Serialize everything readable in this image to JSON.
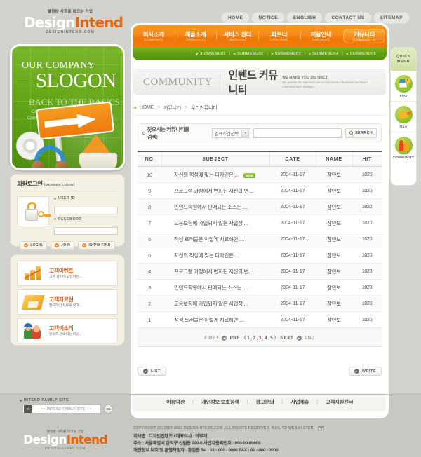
{
  "header": {
    "logo": {
      "tagline": "열정판 사회를 이끄는 기업",
      "name_1": "Design",
      "name_2": "Intend",
      "domain": "DESIGNINTEND.COM"
    },
    "topnav": [
      {
        "label": "HOME"
      },
      {
        "label": "NOTICE"
      },
      {
        "label": "ENGLISH"
      },
      {
        "label": "CONTACT US"
      },
      {
        "label": "SITEMAP"
      }
    ]
  },
  "gnb": {
    "items": [
      {
        "ko": "회사소개",
        "en": "[COMPANY]",
        "active": false
      },
      {
        "ko": "제품소개",
        "en": "[PRODUCT]",
        "active": false
      },
      {
        "ko": "서비스 센터",
        "en": "[SERVICE]",
        "active": false
      },
      {
        "ko": "파트너",
        "en": "[PARTNER]",
        "active": false
      },
      {
        "ko": "채용안내",
        "en": "[RECRUIT]",
        "active": false
      },
      {
        "ko": "커뮤니티",
        "en": "[COMMUNITY]",
        "active": true
      }
    ],
    "submenu": [
      {
        "label": "SUBMENU01"
      },
      {
        "label": "SUBMENU02"
      },
      {
        "label": "SUBMENU03"
      },
      {
        "label": "SUBMENU04"
      },
      {
        "label": "SUBMENU05"
      }
    ]
  },
  "hero": {
    "line1": "OUR COMPANY",
    "line2": "SLOGON",
    "line3": "BACK TO THE BASICS",
    "line4": "Client Focus, Talent Investment Group Contribution ... to support both individual & teams"
  },
  "page": {
    "title_en": "COMMUNITY",
    "title_ko": "인텐드 커뮤니티",
    "slogan_1": "WE MAKE YOU DISTINCT",
    "slogan_2": "We provide the optimized service for clients e-business and brand communication strategy...",
    "breadcrumb": {
      "home": "HOME",
      "level1": "커뮤니티",
      "level2": "우리커뮤니티"
    }
  },
  "search": {
    "label": "찾으시는 커뮤니티를 검색!",
    "select_value": "검색조건선택",
    "input_value": "",
    "input_placeholder": "",
    "button_label": "SEARCH"
  },
  "board": {
    "columns": [
      "NO",
      "SUBJECT",
      "DATE",
      "NAME",
      "HIT"
    ],
    "new_badge": "NEW",
    "rows": [
      {
        "no": "10",
        "subject": "자신의 적성에 맞는 디자인은....",
        "is_new": true,
        "date": "2004-11-17",
        "name": "잠만보",
        "hit": "1020"
      },
      {
        "no": "9",
        "subject": "프로그램 과정에서 변화된 자신의 변....",
        "is_new": false,
        "date": "2004-11-17",
        "name": "잠만보",
        "hit": "1020"
      },
      {
        "no": "8",
        "subject": "인텐드학원에서 판매되는 소스는 ....",
        "is_new": false,
        "date": "2004-11-17",
        "name": "잠만보",
        "hit": "1020"
      },
      {
        "no": "7",
        "subject": "고용보험에 가입되지 않은 사업장....",
        "is_new": false,
        "date": "2004-11-17",
        "name": "잠만보",
        "hit": "1020"
      },
      {
        "no": "6",
        "subject": "적성 트러블은 이렇게 치료하면 ....",
        "is_new": false,
        "date": "2004-11-17",
        "name": "잠만보",
        "hit": "1020"
      },
      {
        "no": "5",
        "subject": "자신의 적성에 맞는 디자인은 ....",
        "is_new": false,
        "date": "2004-11-17",
        "name": "잠만보",
        "hit": "1020"
      },
      {
        "no": "4",
        "subject": "프로그램 과정에서 변화된 자신의 변....",
        "is_new": false,
        "date": "2004-11-17",
        "name": "잠만보",
        "hit": "1020"
      },
      {
        "no": "3",
        "subject": "인텐드학원에서 판매되는 소스는 ....",
        "is_new": false,
        "date": "2004-11-17",
        "name": "잠만보",
        "hit": "1020"
      },
      {
        "no": "2",
        "subject": "고용보험에 가입되지 않은 사업장....",
        "is_new": false,
        "date": "2004-11-17",
        "name": "잠만보",
        "hit": "1020"
      },
      {
        "no": "1",
        "subject": "적성 트러블은 이렇게 치료하면 ....",
        "is_new": false,
        "date": "2004-11-17",
        "name": "잠만보",
        "hit": "1020"
      }
    ],
    "pager": {
      "first": "FIRST",
      "pre": "PRE",
      "next": "NEXT",
      "end": "END",
      "open_bracket": "〈",
      "close_bracket": "〉",
      "pages": [
        "1",
        "2",
        "3",
        "4",
        "5"
      ],
      "current": "3"
    },
    "list_button": "LIST",
    "write_button": "WRITE"
  },
  "footer_links": [
    {
      "label": "이용약관"
    },
    {
      "label": "개인정보 보호정책"
    },
    {
      "label": "광고문의"
    },
    {
      "label": "사업제휴"
    },
    {
      "label": "고객지원센터"
    }
  ],
  "login": {
    "title_ko": "회원로그인",
    "title_en": "[MEMBER LOGIN]",
    "userid_label": "USER ID",
    "userid_value": "",
    "password_label": "PASSWORD",
    "password_value": "",
    "buttons": [
      {
        "label": "LOGIN"
      },
      {
        "label": "JOIN"
      },
      {
        "label": "ID/PW FIND"
      }
    ]
  },
  "services": [
    {
      "title": "고객이벤트",
      "desc": "고객 감사에 보답하는...",
      "icon": "chart-icon"
    },
    {
      "title": "고객자료실",
      "desc": "필요하신 자료를 찾아...",
      "icon": "disk-icon"
    },
    {
      "title": "고객의소리",
      "desc": "단소리 쓴소리는 이곳...",
      "icon": "people-icon"
    }
  ],
  "quick_menu": {
    "title_line1": "QUICK",
    "title_line2": "MENU",
    "items": [
      {
        "label": "FAQ",
        "icon": "faq-icon"
      },
      {
        "label": "Q&A",
        "icon": "qa-icon"
      },
      {
        "label": "COMMUNITY",
        "icon": "community-icon"
      }
    ]
  },
  "family_site": {
    "label": "INTEND FAMILY SITE",
    "select_value": "++ INTEND FAMILY SITE ++",
    "go_label": "GO"
  },
  "footer": {
    "logo": {
      "tagline": "열정판 사회를 이끄는 기업",
      "name_1": "Design",
      "name_2": "Intend",
      "domain": "DESIGNINTEND.COM"
    },
    "copyright": "COPYRIGHT (C) 2000-2003 DESIGNINTEND.COM  ALL RIGHTS RESERVED. MAIL TO WEBMASTER.",
    "company_line": "회사명 : 디자인인텐드 / 대표이사 : 아무개",
    "company_name": "디자인인텐드",
    "address_line": "주소 : 서울특별시 관악구 신림동 000-0  사업자등록번호 : 000-00-00000",
    "privacy_line": "개인정보 보호 및 운영책임자 :  홍길동  Tel : 02 - 000 - 0000  FAX : 02 - 000 - 0000"
  },
  "colors": {
    "orange": "#ef7708",
    "green": "#5f9e12",
    "page_bg": "#d2d2ce",
    "cream": "#f4f1e4",
    "accent_pink": "#e0528c"
  }
}
